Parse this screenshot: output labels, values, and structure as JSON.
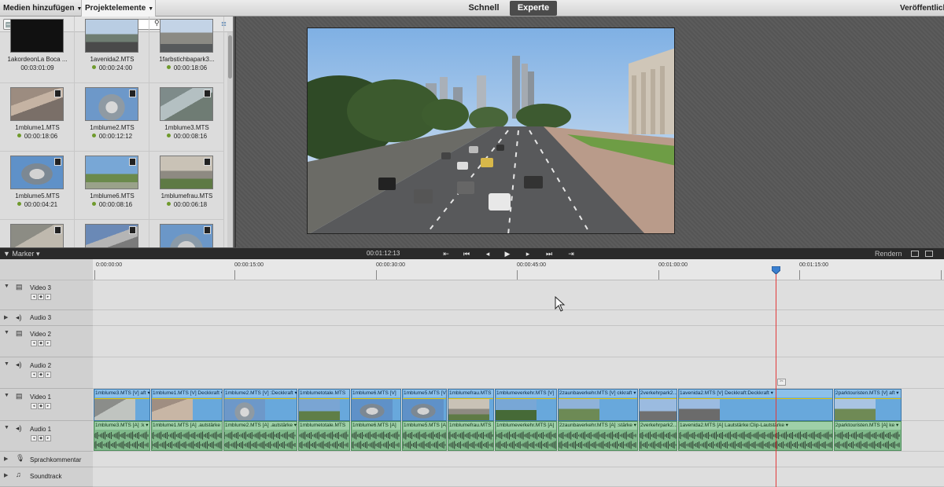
{
  "topbar": {
    "add_media": "Medien hinzufügen",
    "project_assets": "Projektelemente",
    "mode_quick": "Schnell",
    "mode_expert": "Experte",
    "publish": "Veröffentlichen"
  },
  "media": {
    "search_placeholder": "",
    "items": [
      {
        "name": "1akordeonLa Boca ...",
        "duration": "00:03:01:09",
        "dot": false
      },
      {
        "name": "1avenida2.MTS",
        "duration": "00:00:24:00",
        "dot": true
      },
      {
        "name": "1farbstichbapark3...",
        "duration": "00:00:18:06",
        "dot": true
      },
      {
        "name": "1mblume1.MTS",
        "duration": "00:00:18:06",
        "dot": true
      },
      {
        "name": "1mblume2.MTS",
        "duration": "00:00:12:12",
        "dot": true
      },
      {
        "name": "1mblume3.MTS",
        "duration": "00:00:08:16",
        "dot": true
      },
      {
        "name": "1mblume5.MTS",
        "duration": "00:00:04:21",
        "dot": true
      },
      {
        "name": "1mblume6.MTS",
        "duration": "00:00:08:16",
        "dot": true
      },
      {
        "name": "1mblumefrau.MTS",
        "duration": "00:00:06:18",
        "dot": true
      }
    ]
  },
  "transport": {
    "marker": "Marker",
    "current_time": "00:01:12:13",
    "render": "Rendern"
  },
  "ruler": {
    "labels": [
      "0:00:00:00",
      "00:00:15:00",
      "00:00:30:00",
      "00:00:45:00",
      "00:01:00:00",
      "00:01:15:00"
    ]
  },
  "tracks": {
    "video3": "Video 3",
    "audio3": "Audio 3",
    "video2": "Video 2",
    "audio2": "Audio 2",
    "video1": "Video 1",
    "audio1": "Audio 1",
    "narration": "Sprachkommentar",
    "soundtrack": "Soundtrack"
  },
  "video_clips": [
    {
      "label": "1mblume3.MTS [V]  aft ▾"
    },
    {
      "label": "1mblume1.MTS [V] Deckkraft ▾"
    },
    {
      "label": "1mblume2.MTS [V] :Deckkraft ▾"
    },
    {
      "label": "1mblumetotale.MTS"
    },
    {
      "label": "1mblume6.MTS [V]"
    },
    {
      "label": "1mblume5.MTS [V]"
    },
    {
      "label": "1mblumefrau.MTS"
    },
    {
      "label": "1mblumeverkehr.MTS [V]"
    },
    {
      "label": "2zaunbaverkehr.MTS [V]  ckkraft ▾"
    },
    {
      "label": "2verkehrpark2..."
    },
    {
      "label": "1avenida2.MTS [V]   Deckkraft:Deckkraft ▾"
    },
    {
      "label": "2parktouristen.MTS [V]  aft ▾"
    }
  ],
  "audio_clips": [
    {
      "label": "1mblume3.MTS [A]  :k ▾"
    },
    {
      "label": "1mblume1.MTS [A]  .autstärke ▾"
    },
    {
      "label": "1mblume2.MTS [A]  .autstärke ▾"
    },
    {
      "label": "1mblumetotale.MTS"
    },
    {
      "label": "1mblume6.MTS [A]"
    },
    {
      "label": "1mblume5.MTS [A]"
    },
    {
      "label": "1mblumefrau.MTS"
    },
    {
      "label": "1mblumeverkehr.MTS [A]"
    },
    {
      "label": "2zaunbaverkehr.MTS [A]  :stärke ▾"
    },
    {
      "label": "2verkehrpark2..."
    },
    {
      "label": "1avenida2.MTS [A]   Lautstärke:Clip-Lautstärke ▾"
    },
    {
      "label": "2parktouristen.MTS [A]  ke ▾"
    }
  ],
  "icons": [
    "dropdown-caret-icon",
    "media-view-icon",
    "image-icon",
    "audio-icon",
    "search-icon",
    "folder-icon",
    "trash-icon",
    "pin-icon",
    "list-options-icon",
    "filmstrip-icon",
    "go-to-in-icon",
    "step-back-icon",
    "frame-back-icon",
    "play-icon",
    "frame-forward-icon",
    "step-forward-icon",
    "go-to-out-icon",
    "speaker-icon",
    "microphone-icon",
    "music-icon"
  ],
  "colors": {
    "video_clip": "#68a8dc",
    "audio_clip": "#7fb98a",
    "playhead": "#e23a3a",
    "expert_mode_bg": "#4b4b4b"
  }
}
